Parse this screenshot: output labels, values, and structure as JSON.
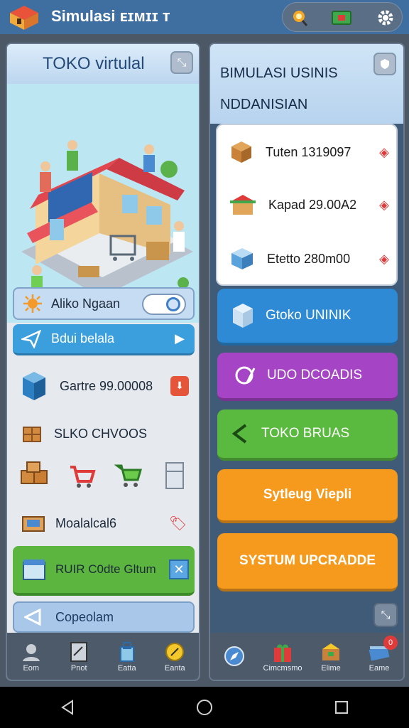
{
  "app": {
    "title": "Simulasi ᴇɪᴍɪɪ ᴛ"
  },
  "colors": {
    "topbar": "#3f6fa1",
    "blue": "#2e8ad4",
    "purple": "#a544c4",
    "green": "#5aba3f",
    "orange": "#f59a1d"
  },
  "top_icons": [
    "trophy-icon",
    "cash-icon",
    "gear-icon"
  ],
  "left_panel": {
    "title": "TOKO virtulal",
    "rows": {
      "toggle_label": "Aliko Ngaan",
      "toggle_on": true,
      "play_label": "Bdui belala",
      "item1": "Gartre 99.00008",
      "item2": "SLKO CHVOOS",
      "item3": "Moalalcal6",
      "cta": "RUIR C0dte Gltum",
      "back": "Copeolam"
    },
    "nav": [
      "Eom",
      "Pnot",
      "Eatta",
      "Eanta"
    ]
  },
  "right_panel": {
    "title1": "BIMULASI USINIS",
    "title2": "NDDANISIAN",
    "stats": [
      "Tuten 1319097",
      "Kapad 29.00A2",
      "Etetto 280m00"
    ],
    "buttons": [
      "Gtoko UNINIK",
      "UDO DCOADIS",
      "TOKO BRUAS",
      "Sytleug Viepli",
      "SYSTUM UPCRADDE"
    ],
    "nav": [
      "Cimcmsmo",
      "Elime",
      "Eame"
    ],
    "badge_count": "0"
  }
}
